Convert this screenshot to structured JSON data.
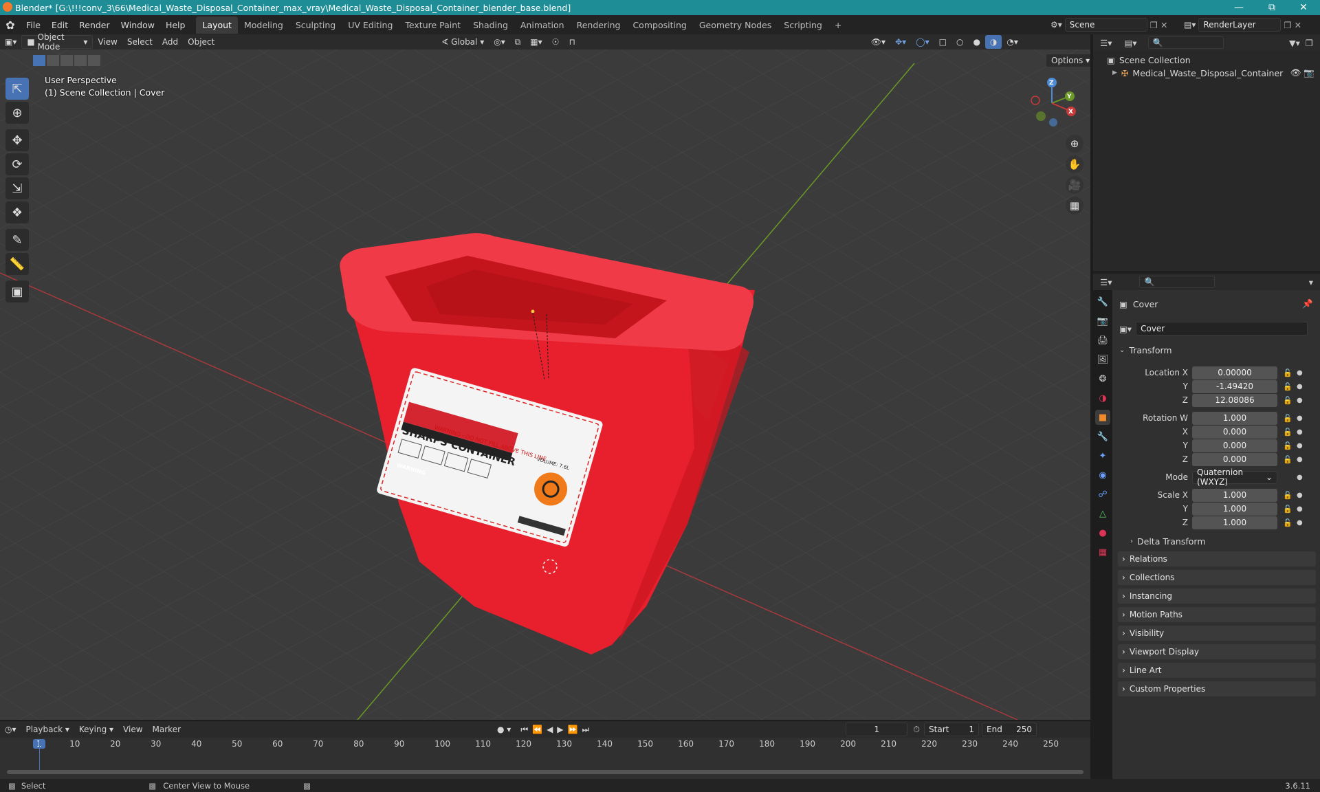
{
  "title": "Blender* [G:\\!!!conv_3\\66\\Medical_Waste_Disposal_Container_max_vray\\Medical_Waste_Disposal_Container_blender_base.blend]",
  "menu": [
    "File",
    "Edit",
    "Render",
    "Window",
    "Help"
  ],
  "workspaces": [
    "Layout",
    "Modeling",
    "Sculpting",
    "UV Editing",
    "Texture Paint",
    "Shading",
    "Animation",
    "Rendering",
    "Compositing",
    "Geometry Nodes",
    "Scripting",
    "+"
  ],
  "scene": {
    "label": "Scene",
    "render_layer": "RenderLayer"
  },
  "viewport_header": {
    "mode": "Object Mode",
    "menus": [
      "View",
      "Select",
      "Add",
      "Object"
    ],
    "orientation": "Global",
    "options": "Options"
  },
  "viewport_info": {
    "line1": "User Perspective",
    "line2": "(1) Scene Collection | Cover"
  },
  "model_label": {
    "warning_top": "WARNING - DO NOT FILL ABOVE THIS LINE",
    "heading": "SHARPS CONTAINER",
    "warning": "WARNING",
    "volume": "VOLUME: 7.6L"
  },
  "gizmo": {
    "x": "X",
    "y": "Y",
    "z": "Z"
  },
  "outliner": {
    "root": "Scene Collection",
    "item": "Medical_Waste_Disposal_Container"
  },
  "properties": {
    "object_name": "Cover",
    "datablock_name": "Cover",
    "transform_header": "Transform",
    "fields": [
      {
        "label": "Location X",
        "value": "0.00000"
      },
      {
        "label": "Y",
        "value": "-1.49420"
      },
      {
        "label": "Z",
        "value": "12.08086"
      },
      {
        "label": "Rotation W",
        "value": "1.000"
      },
      {
        "label": "X",
        "value": "0.000"
      },
      {
        "label": "Y",
        "value": "0.000"
      },
      {
        "label": "Z",
        "value": "0.000"
      },
      {
        "label": "Mode",
        "value": "Quaternion (WXYZ)"
      },
      {
        "label": "Scale X",
        "value": "1.000"
      },
      {
        "label": "Y",
        "value": "1.000"
      },
      {
        "label": "Z",
        "value": "1.000"
      }
    ],
    "delta": "Delta Transform",
    "panels": [
      "Relations",
      "Collections",
      "Instancing",
      "Motion Paths",
      "Visibility",
      "Viewport Display",
      "Line Art",
      "Custom Properties"
    ]
  },
  "timeline": {
    "menus": [
      "Playback",
      "Keying",
      "View",
      "Marker"
    ],
    "current_frame": "1",
    "start_label": "Start",
    "start": "1",
    "end_label": "End",
    "end": "250",
    "ticks": [
      "1",
      "10",
      "20",
      "30",
      "40",
      "50",
      "60",
      "70",
      "80",
      "90",
      "100",
      "110",
      "120",
      "130",
      "140",
      "150",
      "160",
      "170",
      "180",
      "190",
      "200",
      "210",
      "220",
      "230",
      "240",
      "250"
    ]
  },
  "status": {
    "select": "Select",
    "center": "Center View to Mouse",
    "version": "3.6.11"
  },
  "colors": {
    "titlebar": "#1e8d96",
    "accent": "#4772b3",
    "container_red": "#ee1f2e",
    "x_axis": "#c83a3a",
    "y_axis": "#6a9a25"
  }
}
